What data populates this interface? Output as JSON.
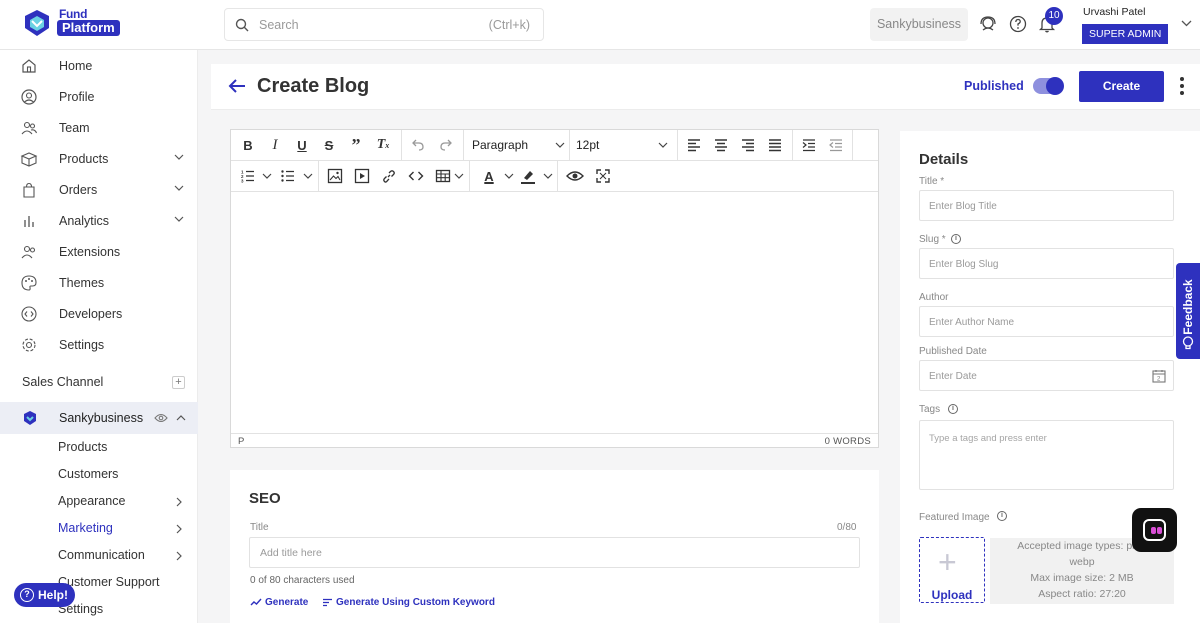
{
  "brand": {
    "line1": "Fund",
    "line2": "Platform"
  },
  "search": {
    "placeholder": "Search",
    "shortcut": "(Ctrl+k)"
  },
  "topbar": {
    "business": "Sankybusiness",
    "notification_count": "10",
    "user_name": "Urvashi Patel",
    "user_role": "SUPER ADMIN"
  },
  "sidebar": {
    "items": [
      {
        "label": "Home",
        "icon": "home-icon"
      },
      {
        "label": "Profile",
        "icon": "profile-icon"
      },
      {
        "label": "Team",
        "icon": "team-icon"
      },
      {
        "label": "Products",
        "icon": "products-icon"
      },
      {
        "label": "Orders",
        "icon": "orders-icon"
      },
      {
        "label": "Analytics",
        "icon": "analytics-icon"
      },
      {
        "label": "Extensions",
        "icon": "extensions-icon"
      },
      {
        "label": "Themes",
        "icon": "themes-icon"
      },
      {
        "label": "Developers",
        "icon": "developers-icon"
      },
      {
        "label": "Settings",
        "icon": "settings-icon"
      }
    ],
    "sales_channel_label": "Sales Channel",
    "channel_name": "Sankybusiness",
    "channel_items": [
      "Products",
      "Customers",
      "Appearance",
      "Marketing",
      "Communication",
      "Customer Support",
      "Settings"
    ],
    "help_label": "Help!"
  },
  "header": {
    "title": "Create Blog",
    "published_label": "Published",
    "published": true,
    "create_label": "Create"
  },
  "editor": {
    "block_format": "Paragraph",
    "font_size": "12pt",
    "status_path": "P",
    "word_count": "0 WORDS"
  },
  "seo": {
    "title": "SEO",
    "title_label": "Title",
    "title_counter": "0/80",
    "title_placeholder": "Add title here",
    "chars_used": "0 of 80 characters used",
    "generate_label": "Generate",
    "generate_custom_label": "Generate Using Custom Keyword"
  },
  "details": {
    "title": "Details",
    "blog_title_label": "Title *",
    "blog_title_placeholder": "Enter Blog Title",
    "slug_label": "Slug *",
    "slug_placeholder": "Enter Blog Slug",
    "author_label": "Author",
    "author_placeholder": "Enter Author Name",
    "date_label": "Published Date",
    "date_placeholder": "Enter Date",
    "tags_label": "Tags",
    "tags_placeholder": "Type a tags and press enter",
    "featured_label": "Featured Image",
    "upload_label": "Upload",
    "image_info": [
      "Accepted image types: png,",
      "webp",
      "Max image size: 2 MB",
      "Aspect ratio: 27:20"
    ]
  },
  "feedback_label": "Feedback",
  "colors": {
    "accent": "#2e31be"
  }
}
